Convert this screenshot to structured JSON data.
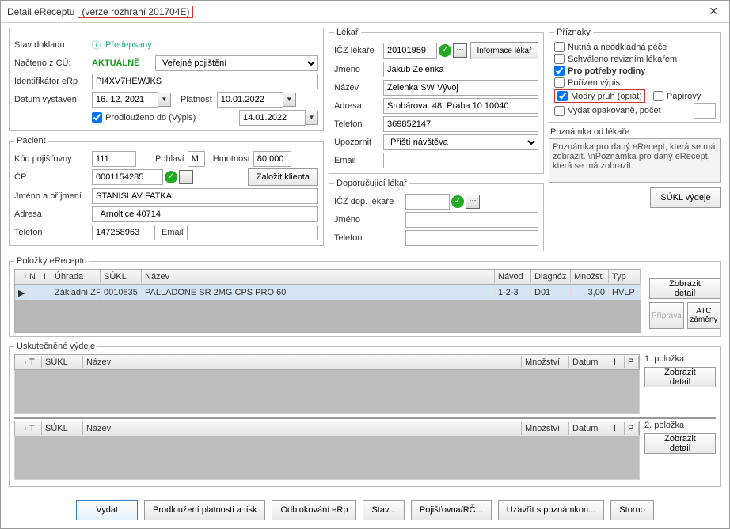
{
  "window": {
    "title_prefix": "Detail eReceptu",
    "version": "(verze rozhraní 201704E)"
  },
  "stav": {
    "label_stav": "Stav dokladu",
    "val_stav": "Předepsaný",
    "label_nacteno": "Načteno z CÚ:",
    "val_nacteno": "AKTUÁLNĚ",
    "pojisteni": "Veřejné pojištění",
    "label_id": "Identifikátor eRp",
    "val_id": "PI4XV7HEWJKS",
    "label_datum": "Datum vystavení",
    "val_datum": "16. 12. 2021",
    "label_platnost": "Platnost",
    "val_platnost": "10.01.2022",
    "chk_prodlouzeno": "Prodlouženo do (Výpis)",
    "val_prodlouzeno": "14.01.2022"
  },
  "pacient": {
    "legend": "Pacient",
    "label_kod": "Kód pojišťovny",
    "val_kod": "111",
    "label_pohlavi": "Pohlaví",
    "val_pohlavi": "M",
    "label_hmot": "Hmotnost",
    "val_hmot": "80,000",
    "label_cp": "ČP",
    "val_cp": "0001154285",
    "btn_zalozit": "Založit klienta",
    "label_jmeno": "Jméno a příjmení",
    "val_jmeno": "STANISLAV FATKA",
    "label_adresa": "Adresa",
    "val_adresa": ", Arnoltice 40714",
    "label_tel": "Telefon",
    "val_tel": "147258963",
    "label_email": "Email",
    "val_email": ""
  },
  "lekar": {
    "legend": "Lékař",
    "label_icz": "IČZ lékaře",
    "val_icz": "20101959",
    "btn_info": "Informace lékař",
    "label_jmeno": "Jméno",
    "val_jmeno": "Jakub Zelenka",
    "label_nazev": "Název",
    "val_nazev": "Zelenka SW Vývoj",
    "label_adresa": "Adresa",
    "val_adresa": "Šrobárova  48, Praha 10 10040",
    "label_tel": "Telefon",
    "val_tel": "369852147",
    "label_upoz": "Upozornit",
    "val_upoz": "Příští návštěva",
    "label_email": "Email",
    "val_email": ""
  },
  "dop": {
    "legend": "Doporučující lékař",
    "label_icz": "IČZ dop. lékaře",
    "label_jmeno": "Jméno",
    "label_tel": "Telefon"
  },
  "priz": {
    "legend": "Příznaky",
    "chk_nutna": "Nutná a neodkladná péče",
    "chk_schval": "Schváleno revizním lékařem",
    "chk_rodina": "Pro potřeby rodiny",
    "chk_vypis": "Pořízen výpis",
    "chk_modry": "Modrý pruh (opiát)",
    "chk_papir": "Papírový",
    "chk_opak": "Vydat opakovaně, počet",
    "note_label": "Poznámka od lékaře",
    "note_text": "Poznámka pro daný eRecept, která se má zobrazit. \\nPoznámka pro daný eRecept, která se má zobrazit.",
    "btn_sukl": "SÚKL výdeje"
  },
  "polozky": {
    "legend": "Položky eReceptu",
    "cols": {
      "n": "N",
      "ex": "!",
      "uhrada": "Úhrada",
      "sukl": "SÚKL",
      "nazev": "Název",
      "navod": "Návod",
      "diag": "Diagnóz",
      "mnoz": "Množst",
      "typ": "Typ"
    },
    "row": {
      "uhrada": "Základní ZP",
      "sukl": "0010835",
      "nazev": "PALLADONE SR 2MG CPS PRO 60",
      "navod": "1-2-3",
      "diag": "D01",
      "mnoz": "3,00",
      "typ": "HVLP"
    },
    "btn_detail": "Zobrazit detail",
    "btn_priprava": "Příprava",
    "btn_atc": "ATC záměny"
  },
  "vydeje": {
    "legend": "Uskutečněné výdeje",
    "cols": {
      "t": "T",
      "sukl": "SÚKL",
      "nazev": "Název",
      "mnoz": "Množství",
      "datum": "Datum",
      "i": "I",
      "p": "P"
    },
    "pol1": "1. položka",
    "pol2": "2. položka",
    "btn_detail": "Zobrazit detail"
  },
  "bottom": {
    "vydat": "Vydat",
    "prodlouz": "Prodloužení platnosti a tisk",
    "odblok": "Odblokování eRp",
    "stav": "Stav...",
    "pojist": "Pojišťovna/RČ...",
    "uzavrit": "Uzavřít s poznámkou...",
    "storno": "Storno"
  }
}
